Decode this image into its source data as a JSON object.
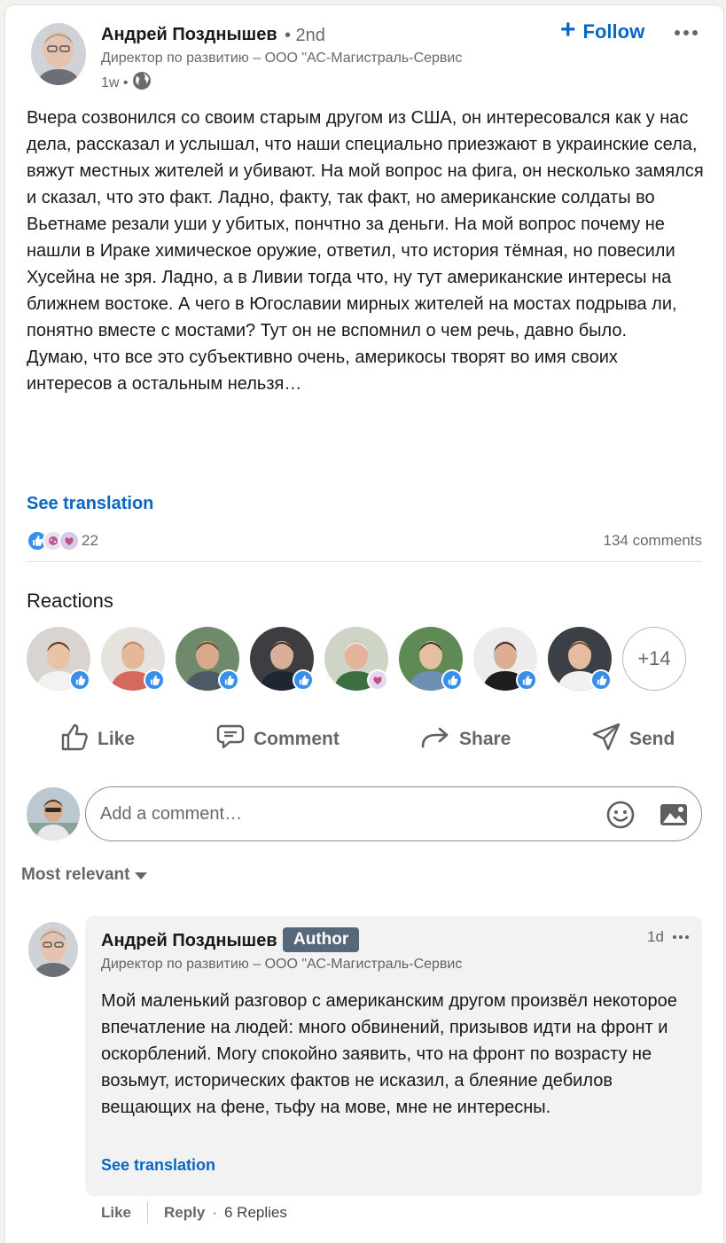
{
  "post": {
    "author_name": "Андрей Позднышев",
    "degree": "• 2nd",
    "author_headline": "Директор по развитию – ООО \"АС-Магистраль-Сервис",
    "time": "1w •",
    "follow_plus": "+",
    "follow_label": "Follow",
    "body": "Вчера созвонился со своим старым другом из США, он интересовался как у нас дела, рассказал и услышал, что наши специально приезжают в украинские села, вяжут местных жителей и убивают. На мой вопрос на фига, он несколько замялся и сказал, что это факт. Ладно, факту, так факт, но американские солдаты во Вьетнаме резали уши у убитых, пончтно за деньги. На мой вопрос почему не нашли в Ираке химическое оружие, ответил, что история тёмная, но повесили Хусейна не зря. Ладно, а в Ливии тогда что, ну тут американские интересы на ближнем востоке. А чего в Югославии мирных жителей на мостах подрыва ли, понятно вместе с мостами? Тут он не вспомнил о чем речь, давно было.\nДумаю, что все это субъективно очень, америкосы творят во имя своих интересов а остальным нельзя…",
    "see_translation": "See translation",
    "reaction_count": "22",
    "comments_count": "134 comments"
  },
  "reactions": {
    "title": "Reactions",
    "more_count": "+14",
    "people": [
      {
        "skin": "#e9c3a6",
        "hair": "#4a2d1f",
        "bg": "#d9d4cf",
        "shirt": "#f2f2f2",
        "reaction": "like"
      },
      {
        "skin": "#e7b79a",
        "hair": "#b98b6e",
        "bg": "#e6e2dd",
        "shirt": "#d46a5c",
        "reaction": "like"
      },
      {
        "skin": "#d9a888",
        "hair": "#5a4030",
        "bg": "#6f8a6b",
        "shirt": "#4c5a66",
        "reaction": "like"
      },
      {
        "skin": "#d8b09a",
        "hair": "#2c2420",
        "bg": "#3e3e42",
        "shirt": "#1e2633",
        "reaction": "like"
      },
      {
        "skin": "#e3b39b",
        "hair": "#e8e8e8",
        "bg": "#cfd5c6",
        "shirt": "#3b6f3f",
        "reaction": "support"
      },
      {
        "skin": "#e6bfa0",
        "hair": "#2b2b2b",
        "bg": "#5d8a55",
        "shirt": "#6c8fb3",
        "reaction": "like"
      },
      {
        "skin": "#dcae94",
        "hair": "#3a2e28",
        "bg": "#ececec",
        "shirt": "#1d1d1d",
        "reaction": "like"
      },
      {
        "skin": "#e4bca2",
        "hair": "#6b4a35",
        "bg": "#3b3f46",
        "shirt": "#f1f1f1",
        "reaction": "like"
      }
    ]
  },
  "actions": {
    "like": "Like",
    "comment": "Comment",
    "share": "Share",
    "send": "Send"
  },
  "composer": {
    "placeholder": "Add a comment…"
  },
  "sort": {
    "label": "Most relevant"
  },
  "comment": {
    "author_name": "Андрей Позднышев",
    "badge": "Author",
    "headline": "Директор по развитию – ООО \"АС-Магистраль-Сервис",
    "time": "1d",
    "body": "Мой маленький разговор с американским другом произвёл некоторое впечатление на людей: много обвинений, призывов идти на фронт и оскорблений. Могу спокойно заявить, что на фронт по возрасту не возьмут, исторических фактов не исказил, а блеяние дебилов вещающих на фене, тьфу на мове, мне не интересны.",
    "see_translation": "See translation",
    "like": "Like",
    "reply": "Reply",
    "dot": "·",
    "replies": "6 Replies"
  },
  "colors": {
    "accent": "#0a66c2",
    "like_blue": "#378fe9",
    "author_badge": "#56687a",
    "comment_bg": "#f2f2f2"
  },
  "icons": {
    "globe": "globe-icon",
    "more": "ellipsis-icon",
    "like": "thumbs-up-icon",
    "comment": "comment-icon",
    "share": "share-arrow-icon",
    "send": "paper-plane-icon",
    "emoji": "emoji-icon",
    "image": "image-icon",
    "caret": "caret-down-icon"
  }
}
